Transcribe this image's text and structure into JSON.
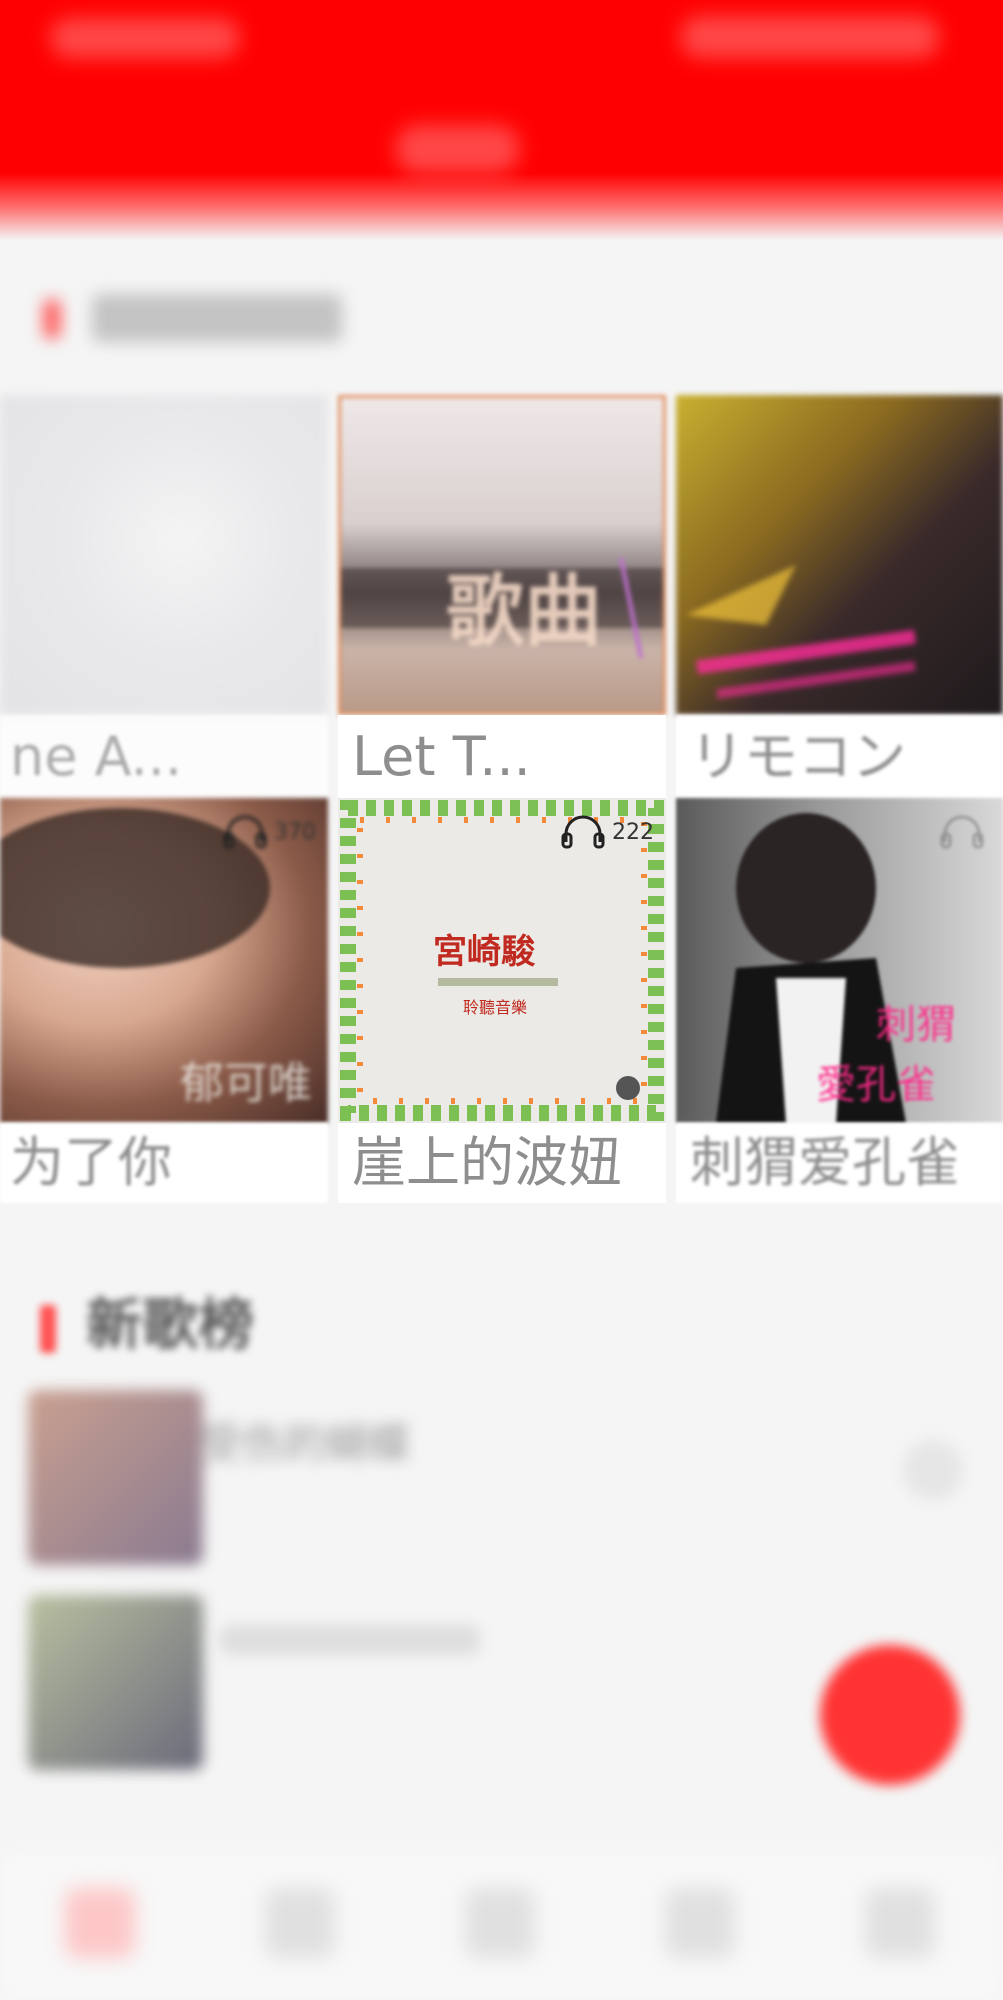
{
  "recommended_playlists": [
    {
      "title": "ne A...",
      "plays": ""
    },
    {
      "title": "Let T...",
      "plays": ""
    },
    {
      "title": "リモコン",
      "plays": ""
    },
    {
      "title": "为了你",
      "plays": "370"
    },
    {
      "title": "崖上的波妞",
      "plays": "222"
    },
    {
      "title": "刺猬爱孔雀",
      "plays": ""
    }
  ],
  "new_songs": {
    "section_title": "新歌榜",
    "songs": [
      {
        "title": "受伤的蝴蝶"
      },
      {
        "title": ""
      }
    ]
  },
  "icons": {
    "play_count": "headphones-icon"
  },
  "colors": {
    "header": "#ff0000",
    "accent": "#ff3333",
    "caption_text": "#8e8e8e"
  }
}
